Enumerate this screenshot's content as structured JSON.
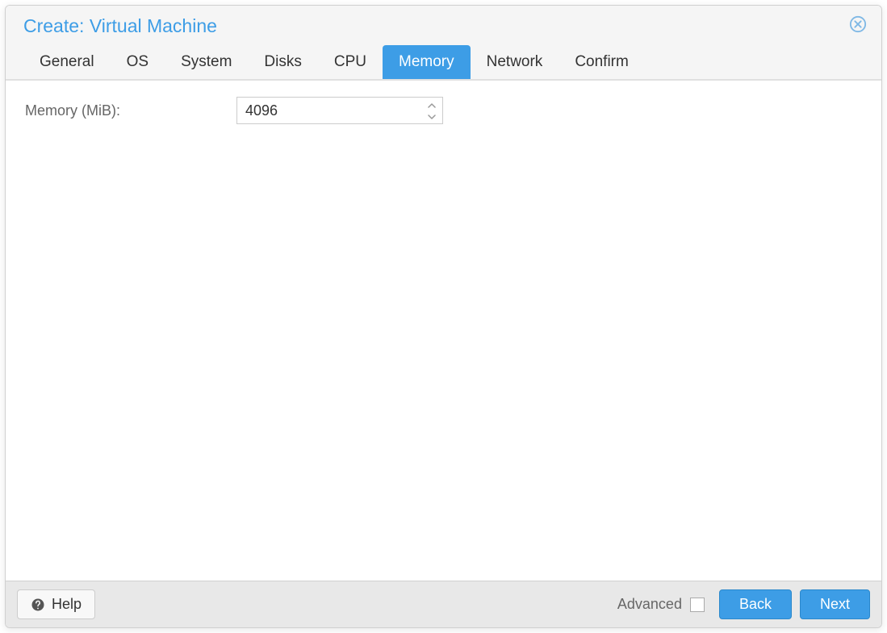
{
  "dialog": {
    "title": "Create: Virtual Machine"
  },
  "tabs": {
    "items": [
      {
        "label": "General"
      },
      {
        "label": "OS"
      },
      {
        "label": "System"
      },
      {
        "label": "Disks"
      },
      {
        "label": "CPU"
      },
      {
        "label": "Memory"
      },
      {
        "label": "Network"
      },
      {
        "label": "Confirm"
      }
    ],
    "active_index": 5
  },
  "memory": {
    "label": "Memory (MiB):",
    "value": "4096"
  },
  "footer": {
    "help_label": "Help",
    "advanced_label": "Advanced",
    "advanced_checked": false,
    "back_label": "Back",
    "next_label": "Next"
  }
}
